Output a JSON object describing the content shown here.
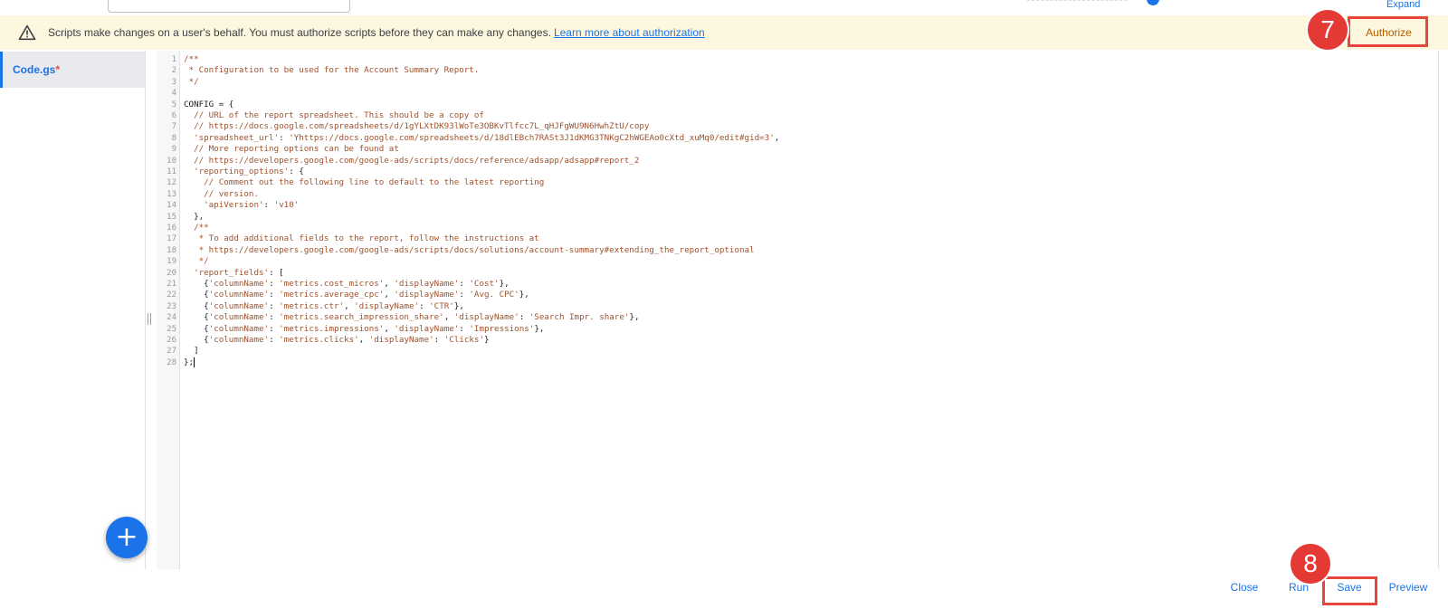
{
  "top": {
    "expand_label": "Expand"
  },
  "banner": {
    "message": "Scripts make changes on a user's behalf. You must authorize scripts before they can make any changes.",
    "link_label": "Learn more about authorization",
    "authorize_label": "Authorize"
  },
  "annotations": {
    "step7": "7",
    "step8": "8"
  },
  "sidebar": {
    "file_name": "Code.gs",
    "modified_marker": "*",
    "add_icon": "plus-icon"
  },
  "editor": {
    "lines": [
      "/**",
      " * Configuration to be used for the Account Summary Report.",
      " */",
      "",
      "CONFIG = {",
      "  // URL of the report spreadsheet. This should be a copy of",
      "  // https://docs.google.com/spreadsheets/d/1gYLXtDK93lWoTe3OBKvTlfcc7L_qHJFgWU9N6HwhZtU/copy",
      "  'spreadsheet_url': 'Yhttps://docs.google.com/spreadsheets/d/18dlEBch7RASt3J1dKMG3TNKgC2hWGEAo0cXtd_xuMq0/edit#gid=3',",
      "  // More reporting options can be found at",
      "  // https://developers.google.com/google-ads/scripts/docs/reference/adsapp/adsapp#report_2",
      "  'reporting_options': {",
      "    // Comment out the following line to default to the latest reporting",
      "    // version.",
      "    'apiVersion': 'v10'",
      "  },",
      "  /**",
      "   * To add additional fields to the report, follow the instructions at",
      "   * https://developers.google.com/google-ads/scripts/docs/solutions/account-summary#extending_the_report_optional",
      "   */",
      "  'report_fields': [",
      "    {'columnName': 'metrics.cost_micros', 'displayName': 'Cost'},",
      "    {'columnName': 'metrics.average_cpc', 'displayName': 'Avg. CPC'},",
      "    {'columnName': 'metrics.ctr', 'displayName': 'CTR'},",
      "    {'columnName': 'metrics.search_impression_share', 'displayName': 'Search Impr. share'},",
      "    {'columnName': 'metrics.impressions', 'displayName': 'Impressions'},",
      "    {'columnName': 'metrics.clicks', 'displayName': 'Clicks'}",
      "  ]",
      "};"
    ]
  },
  "footer": {
    "close_label": "Close",
    "run_label": "Run",
    "save_label": "Save",
    "preview_label": "Preview"
  },
  "colors": {
    "accent": "#1a73e8",
    "highlight": "#e8453c",
    "banner_bg": "#fef7e0",
    "authorize_text": "#b06000"
  }
}
